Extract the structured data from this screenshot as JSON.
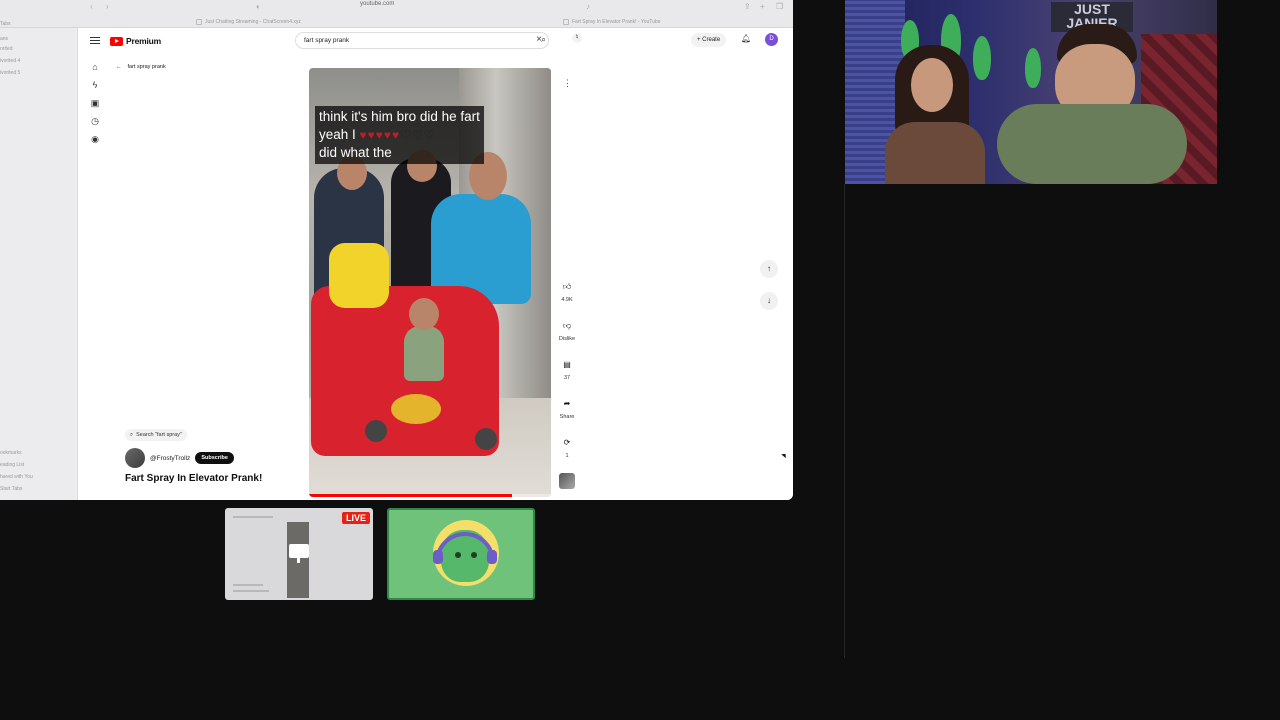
{
  "browser": {
    "url": "youtube.com",
    "tabs": [
      {
        "label": "Just Chatting Streaming - ChatScreen4.xyz"
      },
      {
        "label": "Fart Spray In Elevator Prank! - YouTube"
      }
    ],
    "sidebar_fragments": [
      "Tabs",
      "ans",
      "orited",
      "ivorited 4",
      "ivorited 5",
      "ookmarks",
      "eading List",
      "hared with You",
      "Start Tabs"
    ]
  },
  "youtube": {
    "brand": "Premium",
    "search_query": "fart spray prank",
    "create_label": "Create",
    "avatar_letter": "D",
    "breadcrumb": "fart spray prank",
    "video": {
      "caption_lines": [
        "think it's him bro did he fart",
        "yeah I",
        "did what the"
      ],
      "hearts_filled": 5,
      "hearts_total": 8,
      "progress_fraction": 0.84
    },
    "actions": [
      {
        "icon": "thumbs-up-icon",
        "label": "4.9K"
      },
      {
        "icon": "thumbs-down-icon",
        "label": "Dislike"
      },
      {
        "icon": "comment-icon",
        "label": "37"
      },
      {
        "icon": "share-icon",
        "label": "Share"
      },
      {
        "icon": "remix-icon",
        "label": "1"
      }
    ],
    "search_chip": "Search \"fart spray\"",
    "channel_name": "@FrostyTrollz",
    "subscribe_label": "Subscribe",
    "video_title": "Fart Spray In Elevator Prank!"
  },
  "webcam": {
    "sign_text": "JUST JANIER"
  },
  "tiles": {
    "live_badge": "LIVE"
  },
  "colors": {
    "yt_red": "#ff0000",
    "subscribe_bg": "#0f0f0f",
    "live_red": "#e62117",
    "avatar_tile_green": "#6fc27a"
  }
}
